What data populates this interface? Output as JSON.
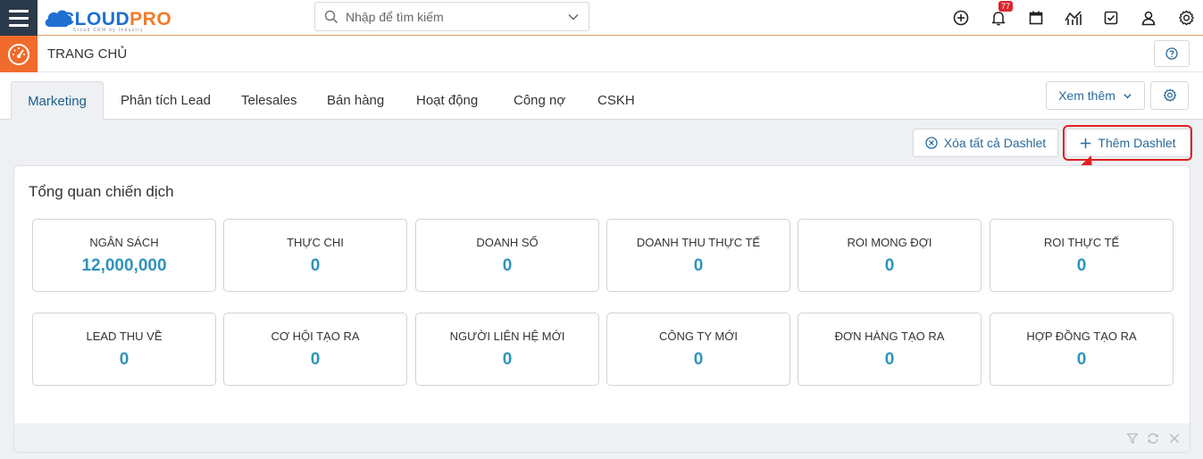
{
  "app": {
    "logo_left": "CLOUD",
    "logo_right": "PRO",
    "logo_tagline": "Cloud CRM by Industry"
  },
  "search": {
    "placeholder": "Nhập để tìm kiếm"
  },
  "topbar": {
    "icons": [
      "add-circle-icon",
      "bell-icon",
      "calendar-icon",
      "chart-icon",
      "checkbox-icon",
      "user-icon",
      "gear-icon"
    ],
    "notification_count": "77"
  },
  "page": {
    "title": "TRANG CHỦ"
  },
  "tabs": [
    {
      "label": "Marketing",
      "active": true
    },
    {
      "label": "Phân tích Lead",
      "active": false
    },
    {
      "label": "Telesales",
      "active": false
    },
    {
      "label": "Bán hàng",
      "active": false
    },
    {
      "label": "Hoạt động",
      "active": false
    },
    {
      "label": "Công nợ",
      "active": false
    },
    {
      "label": "CSKH",
      "active": false
    }
  ],
  "toolbar": {
    "more_label": "Xem thêm",
    "clear_label": "Xóa tất cả Dashlet",
    "add_label": "Thêm Dashlet"
  },
  "dashlet": {
    "title": "Tổng quan chiến dịch",
    "stats": [
      {
        "label": "NGÂN SÁCH",
        "value": "12,000,000"
      },
      {
        "label": "THỰC CHI",
        "value": "0"
      },
      {
        "label": "DOANH SỐ",
        "value": "0"
      },
      {
        "label": "DOANH THU THỰC TẾ",
        "value": "0"
      },
      {
        "label": "ROI MONG ĐỢI",
        "value": "0"
      },
      {
        "label": "ROI THỰC TẾ",
        "value": "0"
      },
      {
        "label": "LEAD THU VỀ",
        "value": "0"
      },
      {
        "label": "CƠ HỘI TẠO RA",
        "value": "0"
      },
      {
        "label": "NGƯỜI LIÊN HỆ MỚI",
        "value": "0"
      },
      {
        "label": "CÔNG TY MỚI",
        "value": "0"
      },
      {
        "label": "ĐƠN HÀNG TẠO RA",
        "value": "0"
      },
      {
        "label": "HỢP ĐỒNG TẠO RA",
        "value": "0"
      }
    ]
  },
  "colors": {
    "accent": "#2f93bd",
    "brand_blue": "#1e6fd1",
    "brand_orange": "#f07b2a",
    "highlight": "#e02020"
  }
}
